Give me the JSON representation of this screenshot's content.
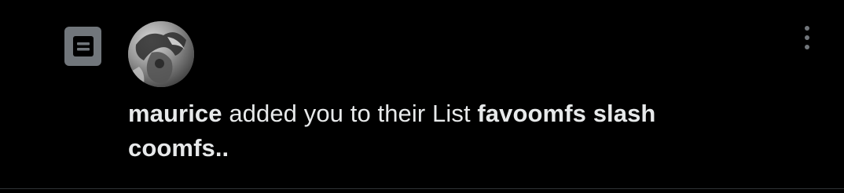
{
  "notification": {
    "type_icon": "list-icon",
    "avatar_icon": "user-avatar",
    "more_icon": "more-vertical-icon",
    "message": {
      "user_name": "maurice",
      "action_text": " added you to their List ",
      "list_name": "favoomfs slash coomfs.."
    }
  },
  "colors": {
    "background": "#000000",
    "text_primary": "#e7e9ea",
    "icon_gray": "#71767b",
    "divider": "#2f3336"
  }
}
